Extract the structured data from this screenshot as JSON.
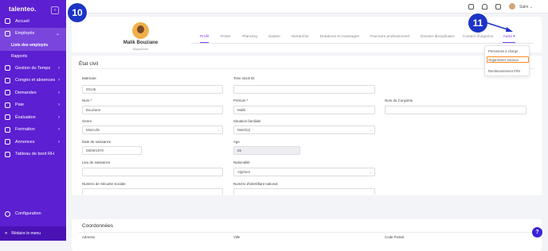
{
  "sidebar": {
    "logo": "talenteo.",
    "items": [
      {
        "label": "Accueil"
      },
      {
        "label": "Employés"
      },
      {
        "label": "Gestion du Temps"
      },
      {
        "label": "Congés et absences"
      },
      {
        "label": "Demandes"
      },
      {
        "label": "Paie"
      },
      {
        "label": "Évaluation"
      },
      {
        "label": "Formation"
      },
      {
        "label": "Annonces"
      },
      {
        "label": "Tableau de bord RH"
      }
    ],
    "sub_items": [
      {
        "label": "Liste des employés"
      },
      {
        "label": "Rapports"
      }
    ],
    "config_label": "Configuration",
    "reduce_label": "Réduire le menu"
  },
  "topbar": {
    "user_name": "Salm"
  },
  "badges": {
    "first": "10",
    "second": "11"
  },
  "profile": {
    "name": "Malik Bouziane",
    "role": "Magasinier"
  },
  "tabs": [
    {
      "label": "Profil"
    },
    {
      "label": "Poste"
    },
    {
      "label": "Planning"
    },
    {
      "label": "Salaire"
    },
    {
      "label": "Hierarchie"
    },
    {
      "label": "Dotations et Avantages"
    },
    {
      "label": "Parcours professionnel"
    },
    {
      "label": "Dossier disciplinaire"
    },
    {
      "label": "Contact d'urgence"
    },
    {
      "label": "Autre ▾"
    }
  ],
  "dropdown": {
    "items": [
      {
        "label": "Personnes à charge"
      },
      {
        "label": "Organismes sociaux"
      },
      {
        "label": "Remboursement Prêt"
      }
    ]
  },
  "etat_civil": {
    "title": "État civil",
    "fields": {
      "matricule": {
        "label": "Matricule",
        "value": "00146"
      },
      "time_clock": {
        "label": "Time clock ID",
        "value": ""
      },
      "nom": {
        "label": "Nom *",
        "value": "Bouziane"
      },
      "prenom": {
        "label": "Prénom *",
        "value": "Malik"
      },
      "nom_conjointe": {
        "label": "Nom du Conjointe",
        "value": ""
      },
      "genre": {
        "label": "Genre",
        "value": "Masculin"
      },
      "situation": {
        "label": "Situation familiale",
        "value": "Marié(e)"
      },
      "date_naissance": {
        "label": "Date de naissance",
        "value": "08/08/1970"
      },
      "age": {
        "label": "Age",
        "value": "55"
      },
      "lieu_naissance": {
        "label": "Lieu de naissance",
        "value": ""
      },
      "nationalite": {
        "label": "Nationalité",
        "value": "Algérien"
      },
      "num_secu": {
        "label": "Numéro de Sécurité Sociale",
        "value": ""
      },
      "num_identifiant": {
        "label": "Numéro d'identifiant national",
        "value": ""
      }
    }
  },
  "coordonnees": {
    "title": "Coordonnées",
    "adresse_label": "Adresse",
    "ville_label": "Ville",
    "code_postal_label": "Code Postal"
  },
  "help_label": "?",
  "colors": {
    "sidebar": "#5c1fd1",
    "accent": "#7b3ff2",
    "badge": "#1d34c6",
    "highlight": "#ff8a1f"
  }
}
